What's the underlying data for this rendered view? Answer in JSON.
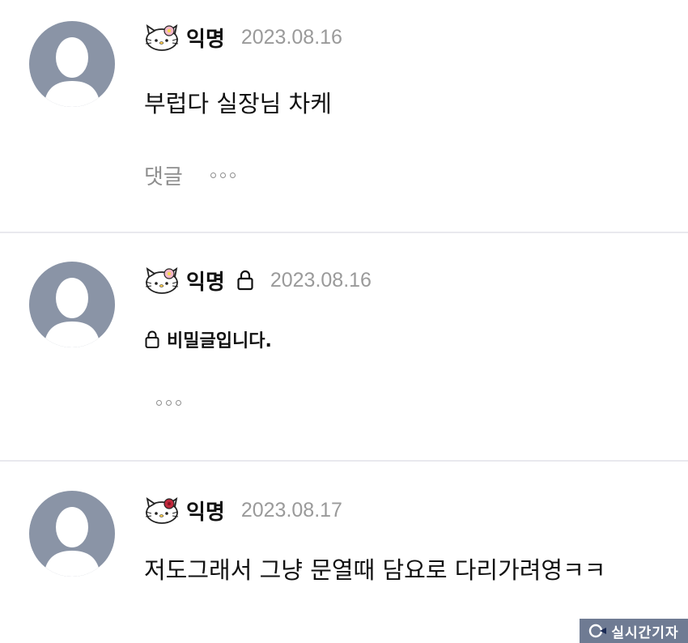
{
  "comments": [
    {
      "author": "익명",
      "date": "2023.08.16",
      "text": "부럽다 실장님 차케",
      "reply_label": "댓글",
      "locked": false
    },
    {
      "author": "익명",
      "date": "2023.08.16",
      "secret_text": "비밀글입니다.",
      "locked": true
    },
    {
      "author": "익명",
      "date": "2023.08.17",
      "text": "저도그래서 그냥 문열때 담요로 다리가려영ㅋㅋ",
      "locked": false
    }
  ],
  "watermark": {
    "text": "실시간기자"
  },
  "colors": {
    "avatar_bg": "#8a94a6",
    "divider": "#e9e9ee",
    "date": "#9a9a9a",
    "watermark_bg": "#6f7b93"
  },
  "icons": [
    "avatar-placeholder-icon",
    "hello-kitty-badge-icon",
    "lock-icon",
    "more-options-icon"
  ]
}
